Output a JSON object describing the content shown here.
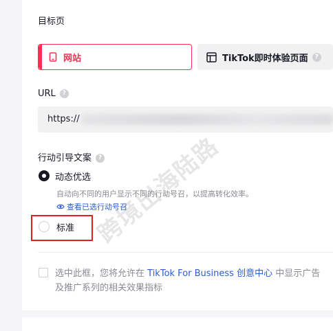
{
  "landing": {
    "section_title": "目标页",
    "options": [
      {
        "label": "网站",
        "icon": "mobile-phone-icon",
        "selected": true
      },
      {
        "label": "TikTok即时体验页面",
        "icon": "layout-icon",
        "selected": false
      }
    ]
  },
  "url": {
    "label": "URL",
    "value": "https://"
  },
  "cta": {
    "section_title": "行动引导文案",
    "dynamic_label": "动态优选",
    "dynamic_desc": "自动向不同的用户显示不同的行动号召，以提高转化效率。",
    "view_link": "查看已选行动号召",
    "standard_label": "标准"
  },
  "consent": {
    "line1_prefix": "选中此框，您将允许在",
    "line1_brand": "TikTok For Business 创意中心",
    "line1_suffix": "中显示广告",
    "line2": "及推广系列的相关效果指标"
  },
  "watermark": "跨境出海陆路",
  "colors": {
    "accent": "#fe2c55",
    "link": "#2a5cd5",
    "highlight": "#e02020"
  }
}
